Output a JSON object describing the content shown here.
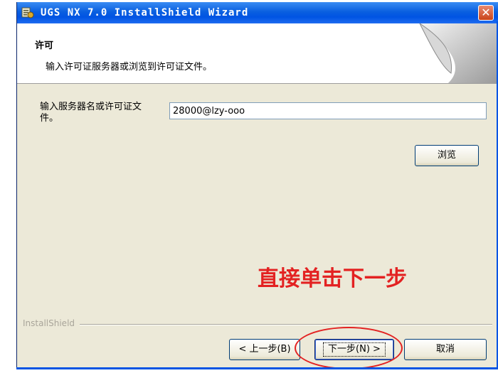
{
  "window": {
    "title": "UGS NX 7.0 InstallShield Wizard",
    "close_label": "✕",
    "app_icon": "installer-icon"
  },
  "header": {
    "title": "许可",
    "subtitle": "输入许可证服务器或浏览到许可证文件。"
  },
  "form": {
    "label": "输入服务器名或许可证文件。",
    "server_value": "28000@lzy-ooo",
    "browse_label": "浏览"
  },
  "annotation": {
    "text": "直接单击下一步",
    "color": "#e32222"
  },
  "footer": {
    "brand": "InstallShield",
    "back_label": "< 上一步(B)",
    "next_label": "下一步(N) >",
    "cancel_label": "取消"
  },
  "colors": {
    "titlebar": "#0054e3",
    "dialog_bg": "#ece9d8",
    "annotation": "#e32222"
  }
}
